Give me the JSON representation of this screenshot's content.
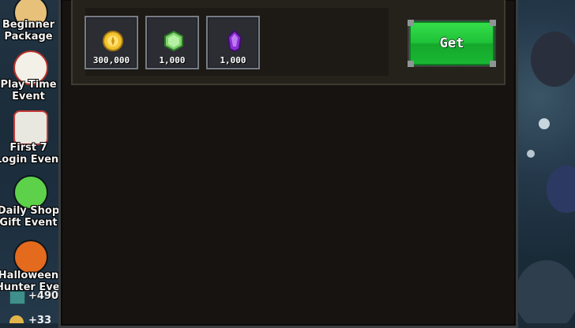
{
  "events": [
    {
      "label_1": "Beginner",
      "label_2": "Package",
      "color": "#e7c07a"
    },
    {
      "label_1": "Play Time",
      "label_2": "Event",
      "color": "#d24a3c"
    },
    {
      "label_1": "First 7",
      "label_2": "Login Event",
      "color": "#4fb36a"
    },
    {
      "label_1": "Daily Shop",
      "label_2": "Gift Event",
      "color": "#5ed14a"
    },
    {
      "label_1": "Halloween",
      "label_2": "Hunter Event",
      "color": "#e46a1e"
    }
  ],
  "counter": {
    "value": "+490",
    "partial_bottom": "+33"
  },
  "rewards": [
    {
      "icon": "gold-coin-icon",
      "quantity": "300,000",
      "color": "#f2c230"
    },
    {
      "icon": "green-gem-icon",
      "quantity": "1,000",
      "color": "#7fd36b"
    },
    {
      "icon": "purple-gem-icon",
      "quantity": "1,000",
      "color": "#8a2fd6"
    }
  ],
  "get_button": {
    "label": "Get",
    "color": "#1fc238"
  }
}
